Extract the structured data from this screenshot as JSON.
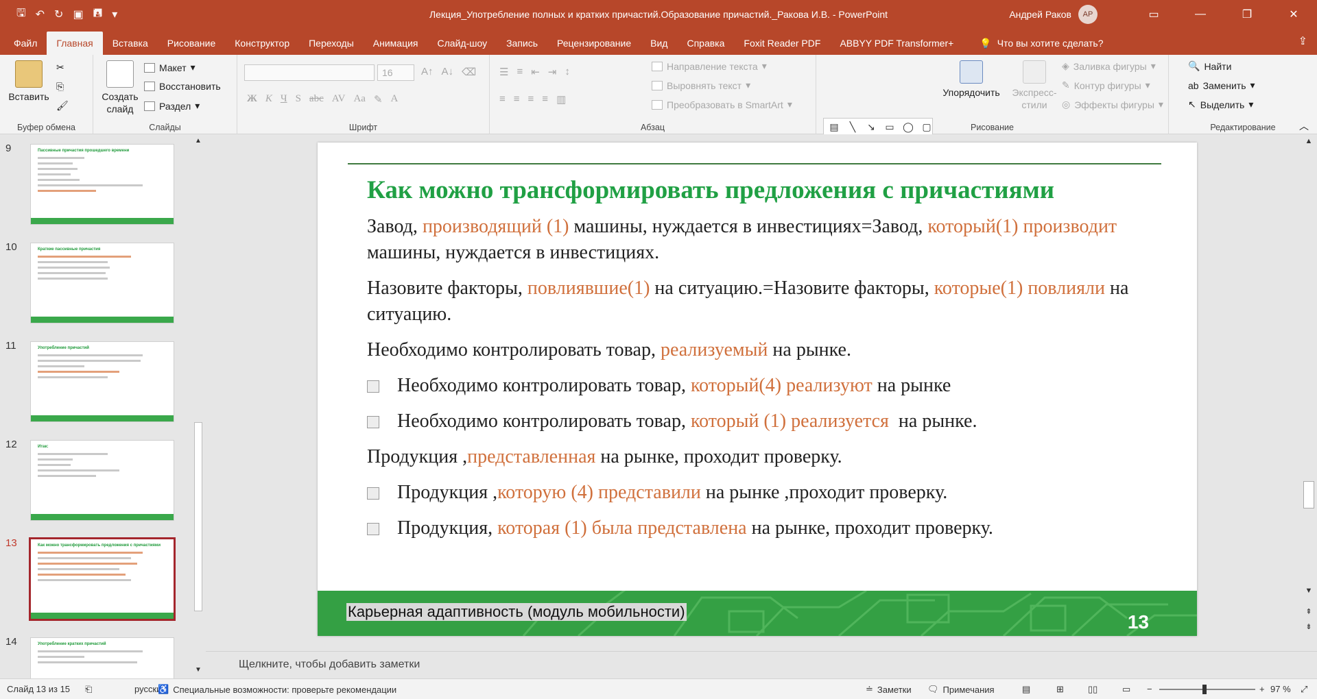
{
  "titlebar": {
    "title": "Лекция_Употребление полных и кратких причастий.Образование причастий._Ракова И.В. - PowerPoint",
    "user": "Андрей Раков",
    "avatar": "АР"
  },
  "tabs": [
    "Файл",
    "Главная",
    "Вставка",
    "Рисование",
    "Конструктор",
    "Переходы",
    "Анимация",
    "Слайд-шоу",
    "Запись",
    "Рецензирование",
    "Вид",
    "Справка",
    "Foxit Reader PDF",
    "ABBYY PDF Transformer+"
  ],
  "active_tab": "Главная",
  "tellme": "Что вы хотите сделать?",
  "ribbon": {
    "clipboard": {
      "paste": "Вставить",
      "label": "Буфер обмена"
    },
    "slides": {
      "new_slide_1": "Создать",
      "new_slide_2": "слайд",
      "layout": "Макет",
      "reset": "Восстановить",
      "section": "Раздел",
      "label": "Слайды"
    },
    "font": {
      "size": "16",
      "label": "Шрифт"
    },
    "paragraph": {
      "direction": "Направление текста",
      "align": "Выровнять текст",
      "smartart": "Преобразовать в SmartArt",
      "label": "Абзац"
    },
    "drawing": {
      "arrange": "Упорядочить",
      "quick_styles_1": "Экспресс-",
      "quick_styles_2": "стили",
      "fill": "Заливка фигуры",
      "outline": "Контур фигуры",
      "effects": "Эффекты фигуры",
      "label": "Рисование"
    },
    "editing": {
      "find": "Найти",
      "replace": "Заменить",
      "select": "Выделить",
      "label": "Редактирование"
    }
  },
  "thumbnails": [
    {
      "num": "9",
      "title": "Пассивные причастия прошедшего времени"
    },
    {
      "num": "10",
      "title": "Краткие пассивные причастия"
    },
    {
      "num": "11",
      "title": "Употребление причастий"
    },
    {
      "num": "12",
      "title": "Итак:"
    },
    {
      "num": "13",
      "title": "Как можно трансформировать предложения с причастиями"
    },
    {
      "num": "14",
      "title": "Употребление кратких причастий"
    }
  ],
  "slide": {
    "title": "Как можно трансформировать предложения с причастиями",
    "p1": {
      "a": "Завод, ",
      "b": "производящий (1)",
      "c": " машины, нуждается в инвестициях=Завод, ",
      "d": "который(1) производит",
      "e": " машины, нуждается в инвестициях."
    },
    "p2": {
      "a": "Назовите факторы, ",
      "b": "повлиявшие(1)",
      "c": " на ситуацию.=Назовите факторы, ",
      "d": "которые(1) повлияли",
      "e": " на ситуацию."
    },
    "p3": {
      "a": "Необходимо контролировать товар, ",
      "b": "реализуемый",
      "c": " на рынке."
    },
    "b1": {
      "a": "Необходимо контролировать товар, ",
      "b": "который(4) реализуют",
      "c": " на рынке"
    },
    "b2": {
      "a": "Необходимо контролировать товар, ",
      "b": "который (1) реализуется",
      "c": "  на рынке."
    },
    "p4": {
      "a": "Продукция ,",
      "b": "представленная",
      "c": " на рынке, проходит проверку."
    },
    "b3": {
      "a": "Продукция ,",
      "b": "которую (4) представили",
      "c": " на рынке ,проходит проверку."
    },
    "b4": {
      "a": "Продукция, ",
      "b": "которая (1) была представлена",
      "c": " на рынке, проходит проверку."
    },
    "footer": "Карьерная адаптивность (модуль мобильности)",
    "number": "13"
  },
  "notes_placeholder": "Щелкните, чтобы добавить заметки",
  "status": {
    "slide": "Слайд 13 из 15",
    "lang": "русский",
    "access": "Специальные возможности: проверьте рекомендации",
    "notes": "Заметки",
    "comments": "Примечания",
    "zoom": "97 %"
  }
}
